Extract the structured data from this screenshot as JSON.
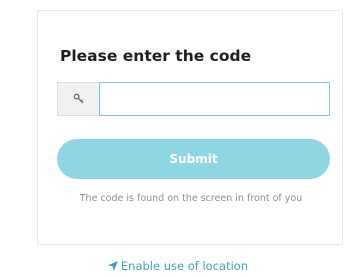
{
  "form": {
    "title": "Please enter the code",
    "code_input": {
      "value": "",
      "placeholder": ""
    },
    "key_icon": "key-icon",
    "submit_label": "Submit",
    "hint": "The code is found on the screen in front of you"
  },
  "footer": {
    "location_icon": "location-arrow-icon",
    "location_label": "Enable use of location"
  },
  "colors": {
    "accent": "#8fd6e3",
    "input_border": "#7cc8dd",
    "link": "#3aa3c4"
  }
}
